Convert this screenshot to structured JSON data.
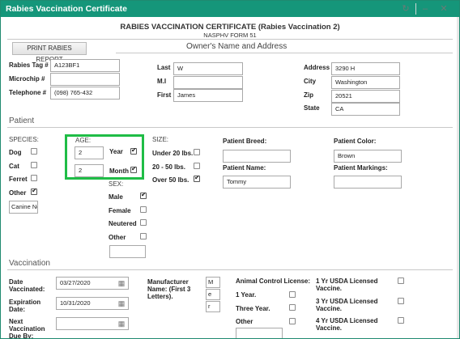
{
  "window": {
    "title": "Rabies Vaccination Certificate",
    "refresh_icon": "refresh-icon",
    "minimize_icon": "minimize-icon",
    "close_icon": "close-icon"
  },
  "header": {
    "title": "RABIES VACCINATION CERTIFICATE (Rabies Vaccination 2)",
    "subtitle": "NASPHV FORM 51"
  },
  "toolbar": {
    "print_label": "PRINT RABIES REPORT"
  },
  "owner": {
    "heading": "Owner's Name and Address",
    "rabies_tag_label": "Rabies Tag #",
    "rabies_tag": "A123BF1",
    "microchip_label": "Microchip #",
    "microchip": "",
    "telephone_label": "Telephone #",
    "telephone": "(098) 765-432",
    "last_label": "Last",
    "last": "W",
    "mi_label": "M.I",
    "mi": "",
    "first_label": "First",
    "first": "James",
    "address_label": "Address",
    "address": "3290 H",
    "city_label": "City",
    "city": "Washington",
    "zip_label": "Zip",
    "zip": "20521",
    "state_label": "State",
    "state": "CA"
  },
  "patient": {
    "heading": "Patient",
    "species_label": "SPECIES:",
    "species": [
      {
        "label": "Dog",
        "checked": false
      },
      {
        "label": "Cat",
        "checked": false
      },
      {
        "label": "Ferret",
        "checked": false
      },
      {
        "label": "Other",
        "checked": true
      }
    ],
    "species_other": "Canine Ne",
    "age_label": "AGE:",
    "age_year_value": "2",
    "age_year_label": "Year",
    "age_year_checked": true,
    "age_month_value": "2",
    "age_month_label": "Month",
    "age_month_checked": true,
    "sex_label": "SEX:",
    "sex": [
      {
        "label": "Male",
        "checked": true
      },
      {
        "label": "Female",
        "checked": false
      },
      {
        "label": "Neutered",
        "checked": false
      },
      {
        "label": "Other",
        "checked": false
      }
    ],
    "sex_other": "",
    "size_label": "SIZE:",
    "sizes": [
      {
        "label": "Under 20 lbs.",
        "checked": false
      },
      {
        "label": "20 - 50 lbs.",
        "checked": false
      },
      {
        "label": "Over 50 lbs.",
        "checked": true
      }
    ],
    "breed_label": "Patient Breed:",
    "breed": "",
    "name_label": "Patient Name:",
    "name": "Tommy",
    "color_label": "Patient Color:",
    "color": "Brown",
    "markings_label": "Patient Markings:",
    "markings": ""
  },
  "vaccination": {
    "heading": "Vaccination",
    "date_vaccinated_label": "Date Vaccinated:",
    "date_vaccinated": "03/27/2020",
    "expiration_label": "Expiration Date:",
    "expiration": "10/31/2020",
    "next_due_label": "Next Vaccination Due By:",
    "next_due": "",
    "manufacturer_label": "Manufacturer Name: (First 3 Letters).",
    "manufacturer_letters": [
      "M",
      "e",
      "r"
    ],
    "animal_control_label": "Animal Control License:",
    "one_year_label": "1 Year.",
    "three_year_label": "Three Year.",
    "other_label": "Other",
    "usda_1": "1 Yr USDA Licensed Vaccine.",
    "usda_3": "3 Yr USDA Licensed Vaccine.",
    "usda_4": "4 Yr USDA Licensed Vaccine."
  }
}
